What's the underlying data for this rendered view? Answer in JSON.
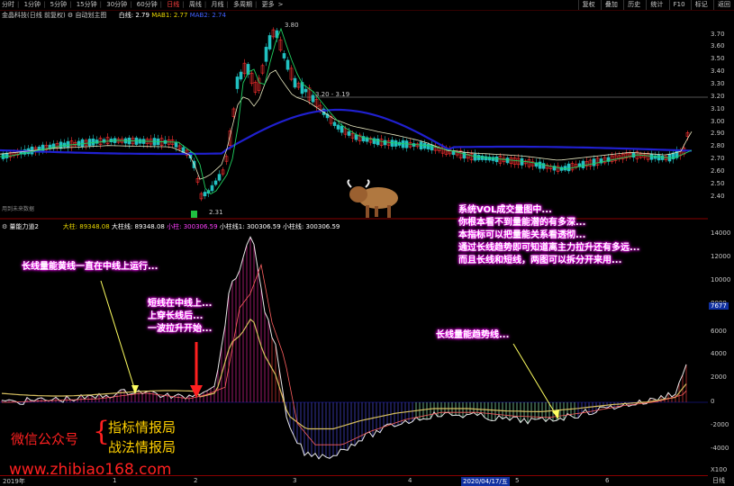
{
  "toolbar": {
    "left": [
      "分时",
      "1分钟",
      "5分钟",
      "15分钟",
      "30分钟",
      "60分钟",
      "日线",
      "周线",
      "月线",
      "多周期",
      "更多"
    ],
    "active_index": 6,
    "right": [
      "复权",
      "叠加",
      "历史",
      "统计",
      "F10",
      "标记",
      "返回"
    ]
  },
  "main_chart": {
    "stock_name": "金晶科技(日线 前复权)",
    "indicator_name": "自动划主图",
    "white_line_label": "白线: 2.79",
    "ma_label": "MAB1: 2.77",
    "ma2_label": "MAB2: 2.74",
    "high_label": "3.80",
    "low_label": "2.31",
    "range_label": "3.20 - 3.19",
    "small_label": "用到未来数据",
    "y_ticks": [
      "3.70",
      "3.60",
      "3.50",
      "3.40",
      "3.30",
      "3.20",
      "3.10",
      "3.00",
      "2.90",
      "2.80",
      "2.70",
      "2.60",
      "2.50",
      "2.40"
    ]
  },
  "sub_chart": {
    "title": "量能力道2",
    "labels": {
      "big": "大柱: 89348.08",
      "big_line": "大柱线: 89348.08",
      "small": "小柱: 300306.59",
      "small_line1": "小柱线1: 300306.59",
      "small_line": "小柱线: 300306.59"
    },
    "y_ticks": [
      "14000",
      "12000",
      "10000",
      "8000",
      "6000",
      "4000",
      "2000",
      "0",
      "-2000",
      "-4000"
    ],
    "value_box": "7677",
    "x_ticks": [
      "2019年",
      "1",
      "2",
      "3",
      "4",
      "2020/04/17/五",
      "5",
      "6"
    ],
    "unit": "X100",
    "period": "日线"
  },
  "notes": {
    "n1": "长线量能黄线一直在中线上运行...",
    "n2a": "短线在中线上...",
    "n2b": "上穿长线后...",
    "n2c": "一波拉升开始...",
    "n3": "长线量能趋势线...",
    "info": [
      "系统VOL成交量图中...",
      "你根本看不到量能潜的有多深...",
      "本指标可以把量能关系看透彻...",
      "通过长线趋势即可知道离主力拉升还有多远...",
      "而且长线和短线，两图可以拆分开来用..."
    ]
  },
  "watermark": {
    "wechat": "微信公众号",
    "line1": "指标情报局",
    "line2": "战法情报局",
    "url": "www.zhibiao168.com"
  },
  "bottom_right": "日线"
}
